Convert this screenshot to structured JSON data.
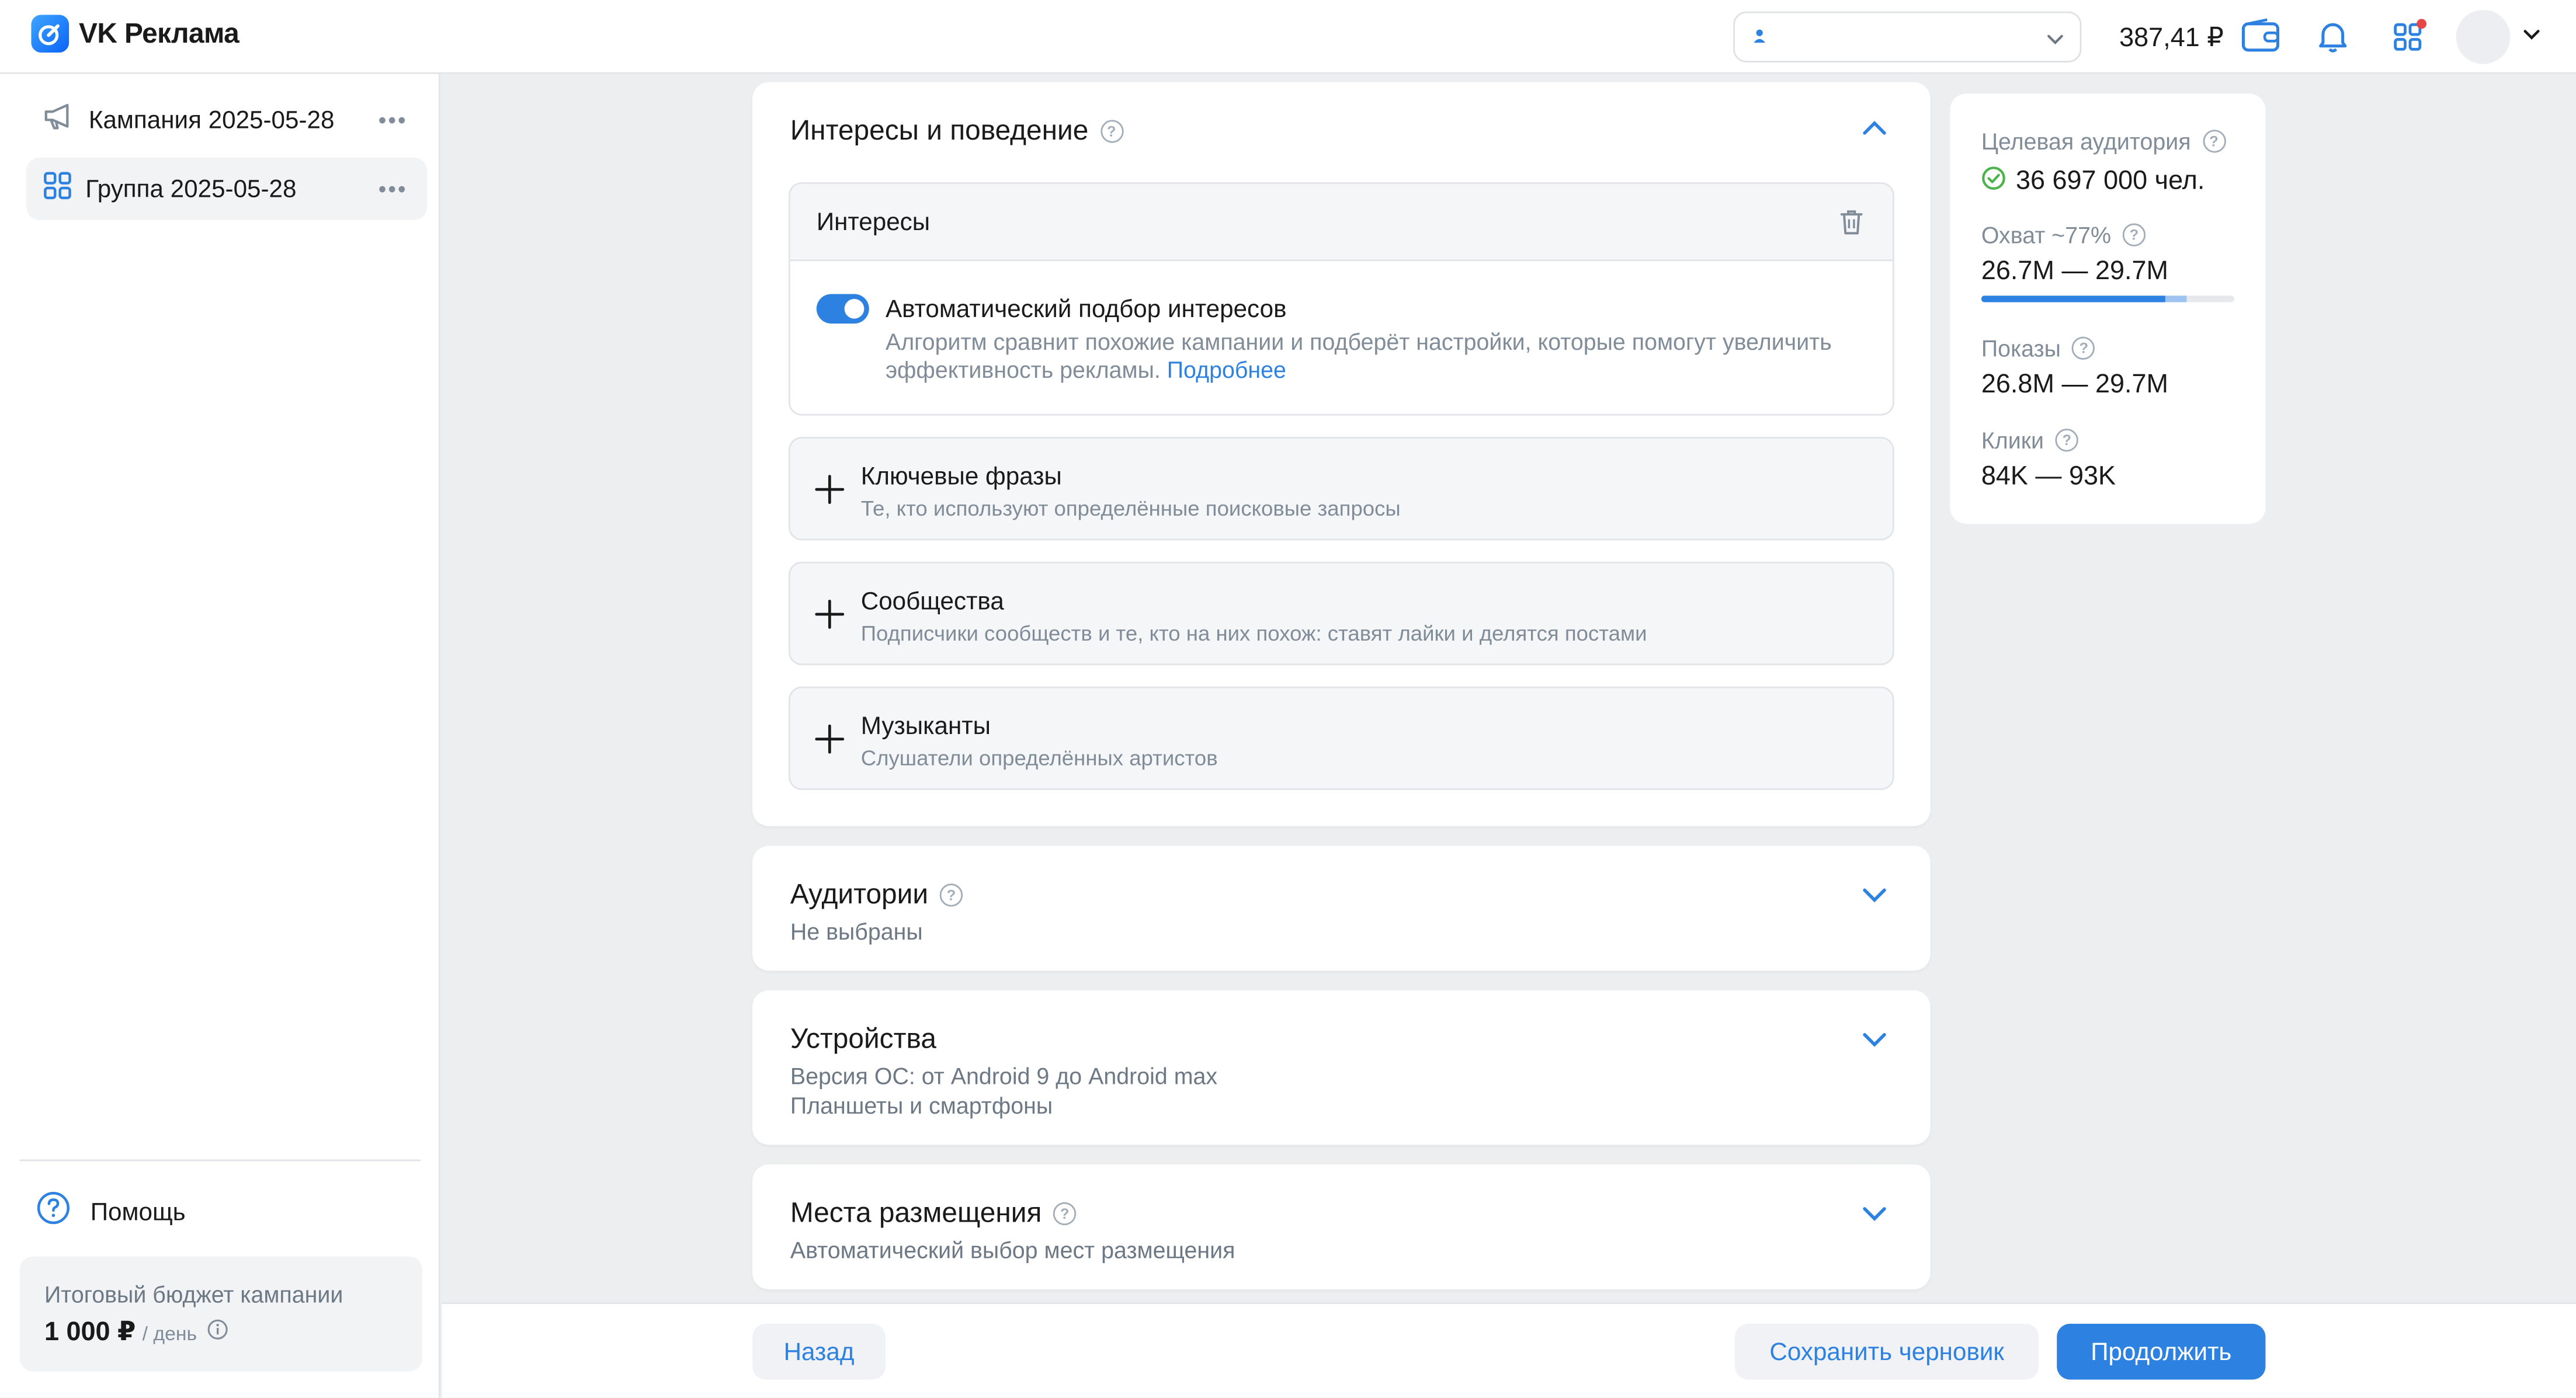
{
  "app": {
    "name": "VK Реклама"
  },
  "topbar": {
    "balance": "387,41 ₽",
    "colors": {
      "accent": "#2d81e0",
      "notification_dot": "#e64646"
    }
  },
  "sidebar": {
    "items": [
      {
        "label": "Кампания 2025-05-28",
        "icon": "megaphone-icon"
      },
      {
        "label": "Группа 2025-05-28",
        "icon": "grid-icon",
        "active": true
      }
    ],
    "help_label": "Помощь",
    "budget": {
      "title": "Итоговый бюджет кампании",
      "amount": "1 000 ₽",
      "period": "/ день"
    }
  },
  "interests_card": {
    "title": "Интересы и поведение",
    "interests_box": {
      "title": "Интересы",
      "auto_title": "Автоматический подбор интересов",
      "auto_desc": "Алгоритм сравнит похожие кампании и подберёт настройки, которые помогут увеличить эффективность рекламы.",
      "auto_link": "Подробнее",
      "toggle_on": true
    },
    "add_rows": [
      {
        "title": "Ключевые фразы",
        "subtitle": "Те, кто используют определённые поисковые запросы"
      },
      {
        "title": "Сообщества",
        "subtitle": "Подписчики сообществ и те, кто на них похож: ставят лайки и делятся постами"
      },
      {
        "title": "Музыканты",
        "subtitle": "Слушатели определённых артистов"
      }
    ]
  },
  "audiences_card": {
    "title": "Аудитории",
    "subtitle": "Не выбраны"
  },
  "devices_card": {
    "title": "Устройства",
    "subtitle_1": "Версия ОС: от Android 9 до Android max",
    "subtitle_2": "Планшеты и смартфоны"
  },
  "placements_card": {
    "title": "Места размещения",
    "subtitle": "Автоматический выбор мест размещения"
  },
  "stats": {
    "audience_label": "Целевая аудитория",
    "audience_value": "36 697 000 чел.",
    "reach_label": "Охват ~77%",
    "reach_value": "26.7M — 29.7M",
    "reach_progress": 0.73,
    "reach_progress_range_end": 0.81,
    "impressions_label": "Показы",
    "impressions_value": "26.8M — 29.7M",
    "clicks_label": "Клики",
    "clicks_value": "84K — 93K"
  },
  "footer": {
    "back_label": "Назад",
    "save_label": "Сохранить черновик",
    "continue_label": "Продолжить"
  }
}
